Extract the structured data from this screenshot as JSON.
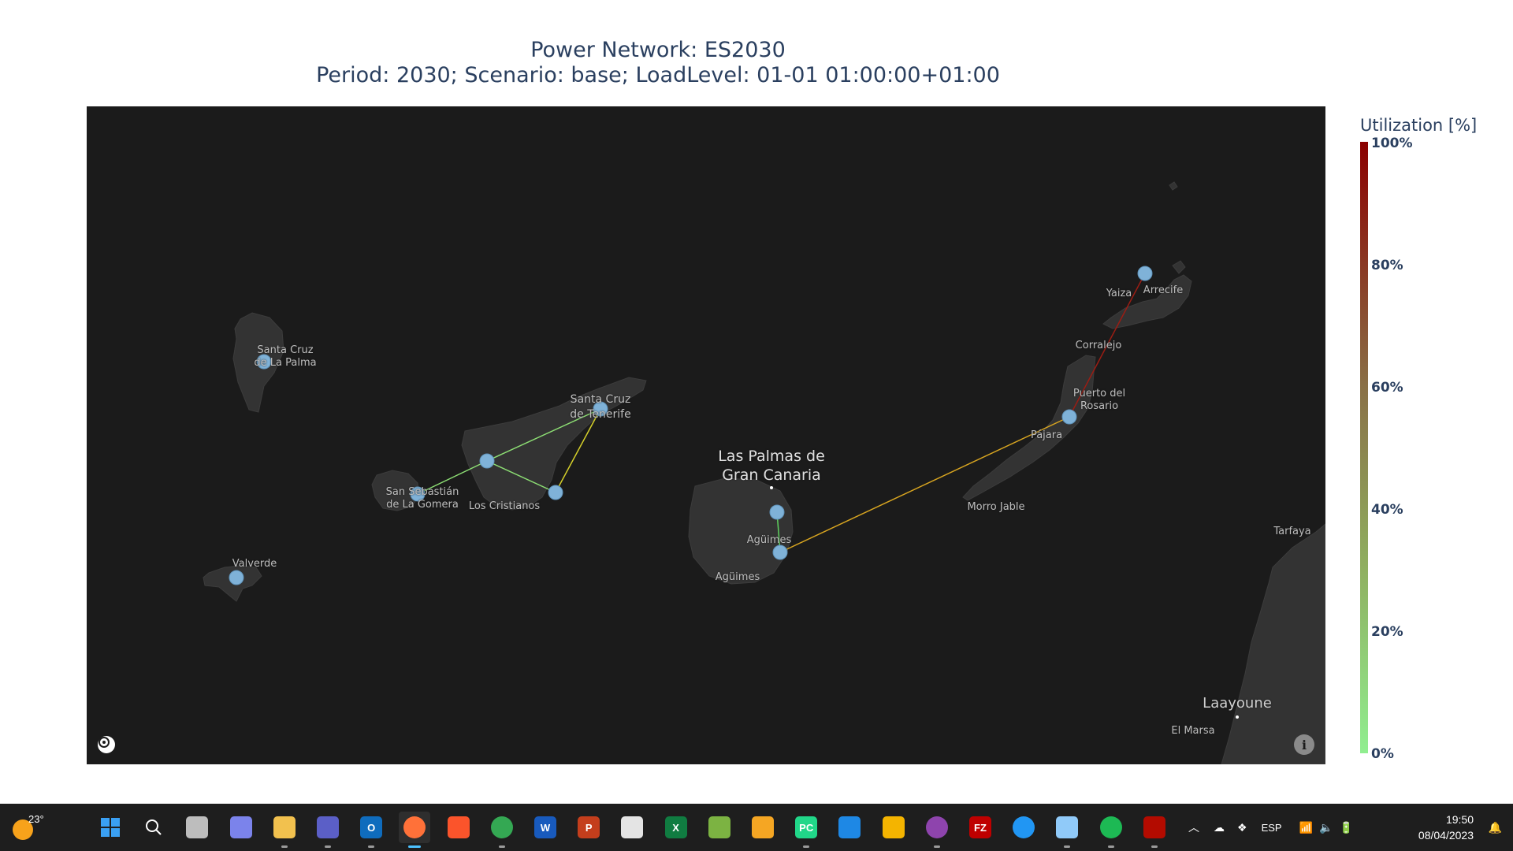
{
  "title": {
    "line1": "Power Network: ES2030",
    "line2": "Period: 2030; Scenario: base; LoadLevel: 01-01 01:00:00+01:00"
  },
  "map": {
    "place_labels": [
      {
        "id": "santa-cruz-la-palma",
        "lines": [
          "Santa Cruz",
          "de La Palma"
        ],
        "style": "small"
      },
      {
        "id": "valverde",
        "lines": [
          "Valverde"
        ],
        "style": "small"
      },
      {
        "id": "san-sebastian",
        "lines": [
          "San Sebastián",
          "de La Gomera"
        ],
        "style": "small"
      },
      {
        "id": "los-cristianos",
        "lines": [
          "Los Cristianos"
        ],
        "style": "small"
      },
      {
        "id": "santa-cruz-tenerife",
        "lines": [
          "Santa Cruz",
          "de Tenerife"
        ],
        "style": "small14"
      },
      {
        "id": "las-palmas",
        "lines": [
          "Las Palmas de",
          "Gran Canaria"
        ],
        "style": "big"
      },
      {
        "id": "aguimes-1",
        "lines": [
          "Agüimes"
        ],
        "style": "small"
      },
      {
        "id": "aguimes-2",
        "lines": [
          "Agüimes"
        ],
        "style": "small"
      },
      {
        "id": "yaiza",
        "lines": [
          "Yaiza"
        ],
        "style": "small"
      },
      {
        "id": "arrecife",
        "lines": [
          "Arrecife"
        ],
        "style": "small"
      },
      {
        "id": "corralejo",
        "lines": [
          "Corralejo"
        ],
        "style": "small"
      },
      {
        "id": "puerto-rosario",
        "lines": [
          "Puerto del",
          "Rosario"
        ],
        "style": "small"
      },
      {
        "id": "pajara",
        "lines": [
          "Pájara"
        ],
        "style": "small"
      },
      {
        "id": "morro-jable",
        "lines": [
          "Morro Jable"
        ],
        "style": "small"
      },
      {
        "id": "tarfaya",
        "lines": [
          "Tarfaya"
        ],
        "style": "small"
      },
      {
        "id": "laayoune",
        "lines": [
          "Laayoune"
        ],
        "style": "medium"
      },
      {
        "id": "el-marsa",
        "lines": [
          "El Marsa"
        ],
        "style": "small"
      }
    ],
    "nodes": [
      "La Palma",
      "El Hierro",
      "La Gomera",
      "Tenerife Center",
      "Tenerife South",
      "Tenerife North",
      "Gran Canaria North",
      "Gran Canaria South",
      "Fuerteventura",
      "Lanzarote"
    ],
    "lines": [
      {
        "from": "La Gomera",
        "to": "Tenerife Center",
        "utilization_pct": 20,
        "color": "#8ddf74"
      },
      {
        "from": "Tenerife Center",
        "to": "Tenerife North",
        "utilization_pct": 15,
        "color": "#8ddf74"
      },
      {
        "from": "Tenerife Center",
        "to": "Tenerife South",
        "utilization_pct": 15,
        "color": "#8ddf74"
      },
      {
        "from": "Tenerife South",
        "to": "Tenerife North",
        "utilization_pct": 40,
        "color": "#d4cf2a"
      },
      {
        "from": "Gran Canaria North",
        "to": "Gran Canaria South",
        "utilization_pct": 10,
        "color": "#5fd35f"
      },
      {
        "from": "Gran Canaria South",
        "to": "Fuerteventura",
        "utilization_pct": 45,
        "color": "#d8a520"
      },
      {
        "from": "Fuerteventura",
        "to": "Lanzarote",
        "utilization_pct": 95,
        "color": "#9b1d14"
      }
    ],
    "node_color": "#7fb2d8"
  },
  "colorbar": {
    "title": "Utilization [%]",
    "ticks": [
      "100%",
      "80%",
      "60%",
      "40%",
      "20%",
      "0%"
    ],
    "low_color": "#90ee90",
    "high_color": "#8b0000"
  },
  "taskbar": {
    "temperature": "23°",
    "apps": [
      "start-icon",
      "search-icon",
      "task-view-icon",
      "teams-chat-icon",
      "file-explorer-icon",
      "teams-icon",
      "outlook-icon",
      "firefox-icon",
      "brave-icon",
      "chrome-icon",
      "word-icon",
      "powerpoint-icon",
      "acrobat-icon",
      "excel-icon",
      "image-editor-icon",
      "app-icon",
      "pycharm-icon",
      "vscode-icon",
      "file-transfer-icon",
      "github-desktop-icon",
      "filezilla-icon",
      "browser-icon",
      "chart-icon",
      "spotify-icon",
      "acrobat-reader-icon"
    ],
    "app_letters": {
      "excel-icon": "X",
      "word-icon": "W",
      "outlook-icon": "O",
      "powerpoint-icon": "P",
      "pycharm-icon": "PC",
      "filezilla-icon": "FZ"
    },
    "language": "ESP",
    "time": "19:50",
    "date": "08/04/2023"
  }
}
